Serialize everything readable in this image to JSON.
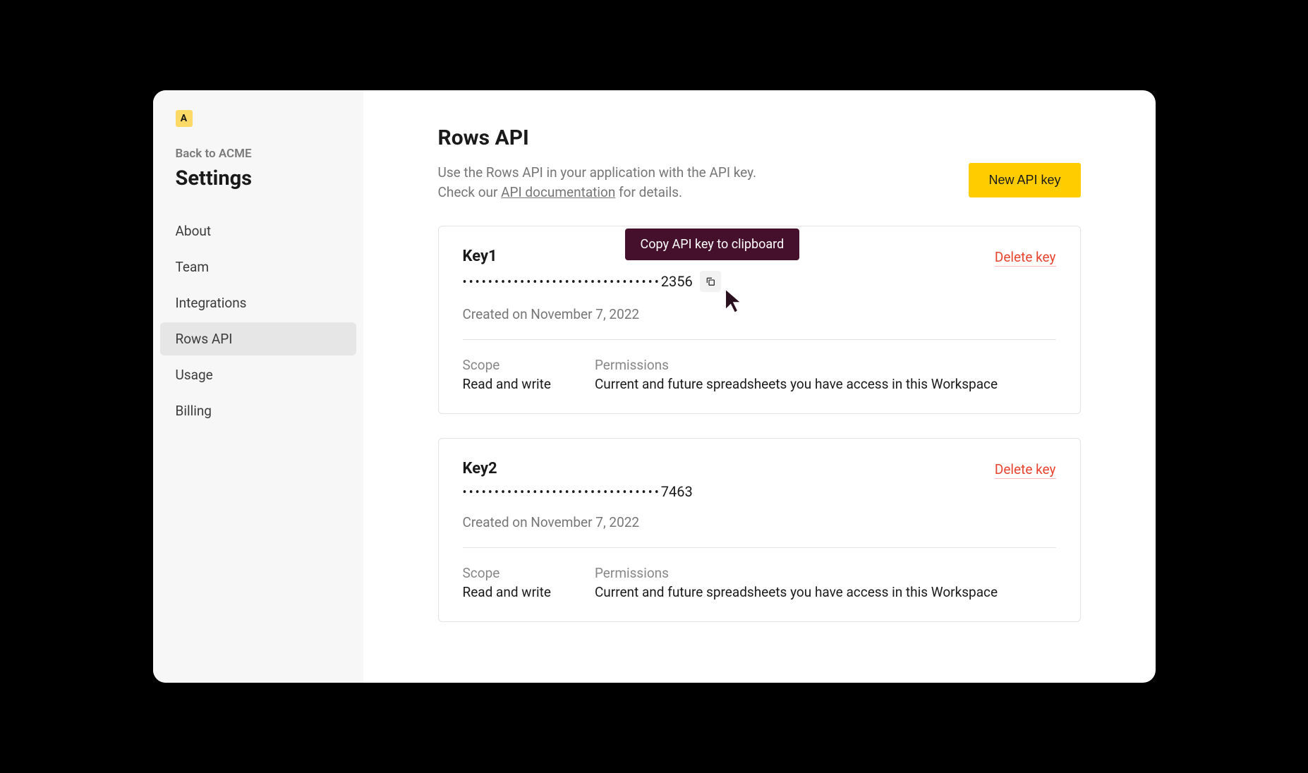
{
  "workspace": {
    "badge": "A",
    "back_label": "Back to ACME"
  },
  "settings_title": "Settings",
  "nav": {
    "items": [
      {
        "label": "About"
      },
      {
        "label": "Team"
      },
      {
        "label": "Integrations"
      },
      {
        "label": "Rows API",
        "active": true
      },
      {
        "label": "Usage"
      },
      {
        "label": "Billing"
      }
    ]
  },
  "page": {
    "title": "Rows API",
    "description_line1": "Use the Rows API in your application with the API key.",
    "description_prefix": "Check our ",
    "doc_link_text": "API documentation",
    "description_suffix": " for details.",
    "new_key_button": "New API key"
  },
  "tooltip": {
    "copy": "Copy API key to clipboard"
  },
  "keys": [
    {
      "name": "Key1",
      "masked_dots": "•••••••••••••••••••••••••••••••",
      "suffix": "2356",
      "created": "Created on November 7, 2022",
      "delete_label": "Delete key",
      "scope_label": "Scope",
      "scope_value": "Read and write",
      "permissions_label": "Permissions",
      "permissions_value": "Current and future spreadsheets you have access in this Workspace",
      "show_copy": true
    },
    {
      "name": "Key2",
      "masked_dots": "•••••••••••••••••••••••••••••••",
      "suffix": "7463",
      "created": "Created on November 7, 2022",
      "delete_label": "Delete key",
      "scope_label": "Scope",
      "scope_value": "Read and write",
      "permissions_label": "Permissions",
      "permissions_value": "Current and future spreadsheets you have access in this Workspace",
      "show_copy": false
    }
  ]
}
